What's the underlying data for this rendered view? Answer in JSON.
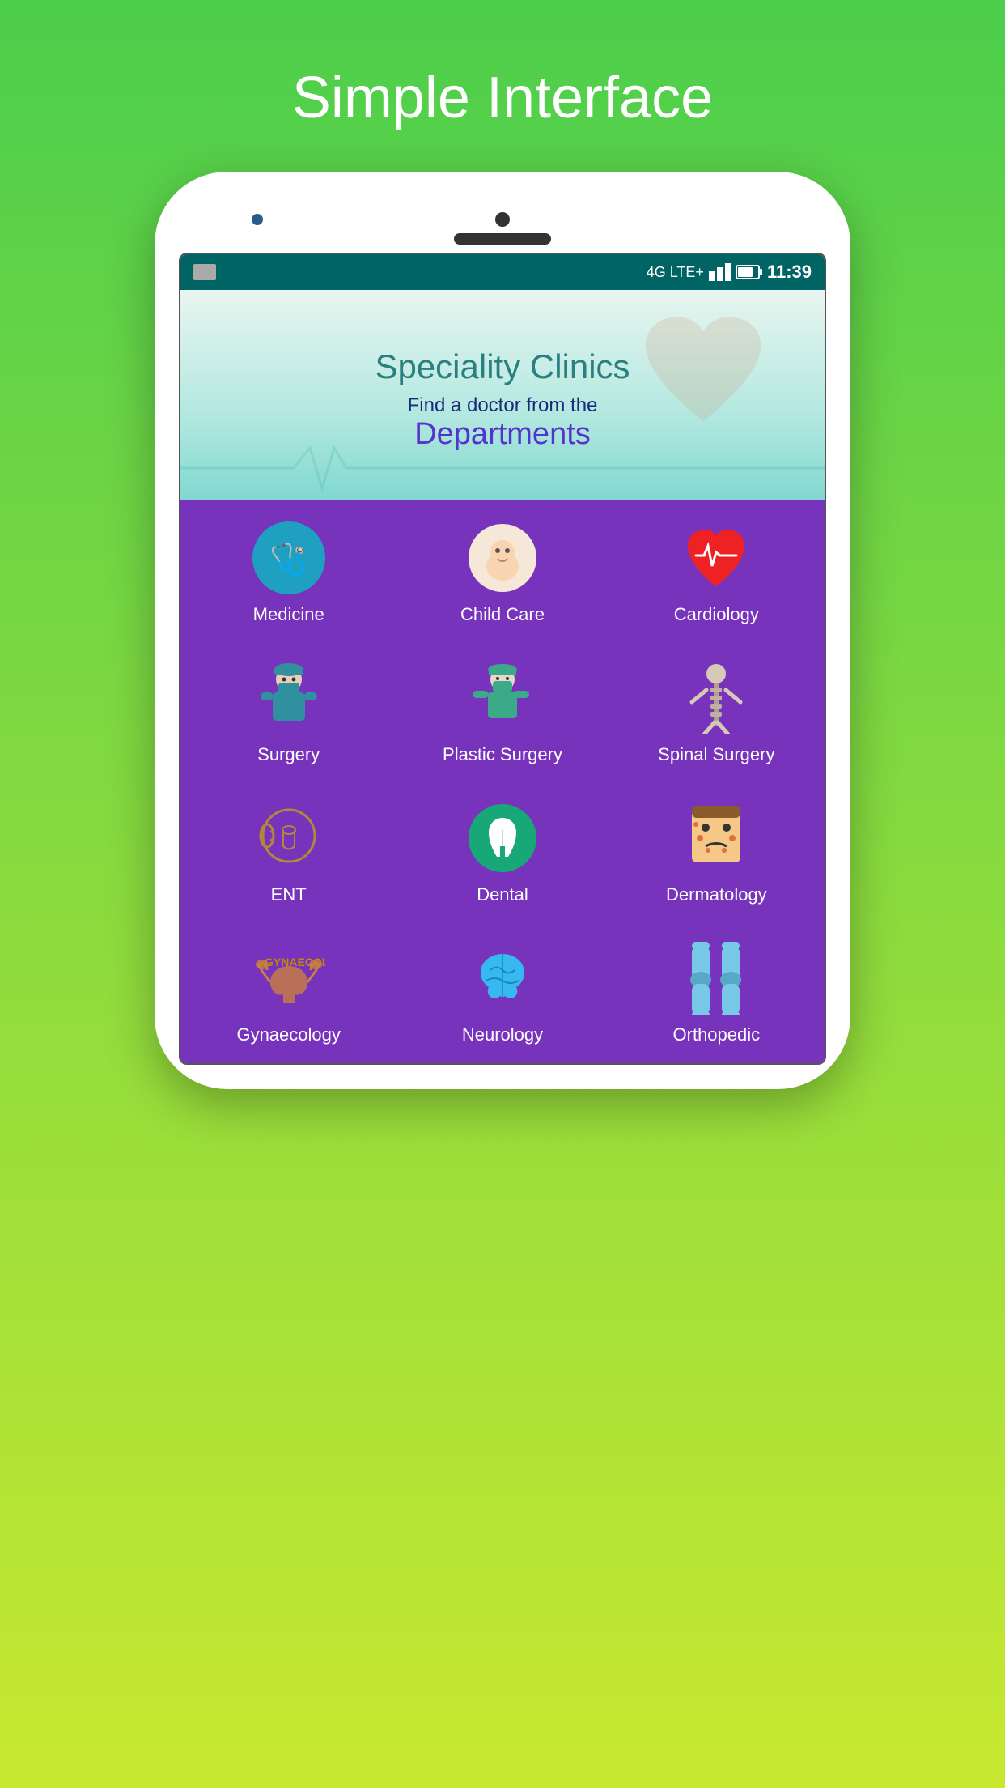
{
  "header": {
    "title": "Simple ",
    "title_bold": "Interface"
  },
  "status_bar": {
    "time": "11:39",
    "network": "4G LTE+"
  },
  "banner": {
    "title": "Speciality Clinics",
    "subtitle1": "Find a doctor from the",
    "subtitle2": "Departments"
  },
  "departments": [
    {
      "id": "medicine",
      "label": "Medicine",
      "icon_type": "stethoscope"
    },
    {
      "id": "child-care",
      "label": "Child Care",
      "icon_type": "baby"
    },
    {
      "id": "cardiology",
      "label": "Cardiology",
      "icon_type": "heart-ecg"
    },
    {
      "id": "surgery",
      "label": "Surgery",
      "icon_type": "surgeon"
    },
    {
      "id": "plastic-surgery",
      "label": "Plastic Surgery",
      "icon_type": "plastic-surgeon"
    },
    {
      "id": "spinal-surgery",
      "label": "Spinal Surgery",
      "icon_type": "spine"
    },
    {
      "id": "ent",
      "label": "ENT",
      "icon_type": "ent"
    },
    {
      "id": "dental",
      "label": "Dental",
      "icon_type": "tooth"
    },
    {
      "id": "dermatology",
      "label": "Dermatology",
      "icon_type": "skin"
    },
    {
      "id": "gynaecology",
      "label": "Gynaecology",
      "icon_type": "gynaecology"
    },
    {
      "id": "neurology",
      "label": "Neurology",
      "icon_type": "brain"
    },
    {
      "id": "orthopedic",
      "label": "Orthopedic",
      "icon_type": "bone"
    }
  ],
  "colors": {
    "bg_gradient_top": "#4cce4c",
    "bg_gradient_bottom": "#c8e830",
    "grid_bg": "#7733bb",
    "status_bar": "#006464",
    "banner_title": "#2a8080",
    "banner_dept_color": "#5533cc"
  }
}
